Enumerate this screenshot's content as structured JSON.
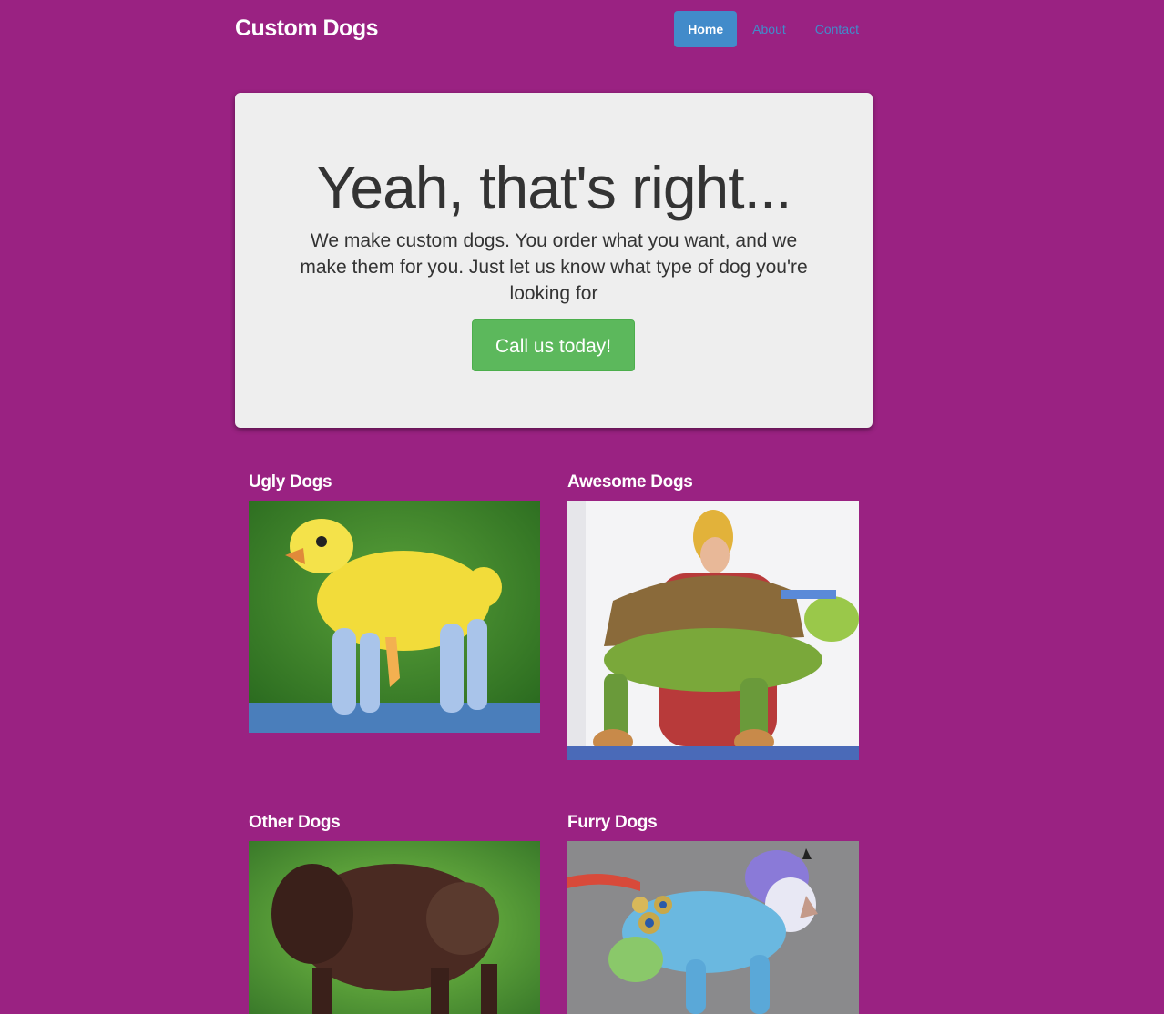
{
  "brand": "Custom Dogs",
  "nav": [
    {
      "label": "Home",
      "active": true
    },
    {
      "label": "About",
      "active": false
    },
    {
      "label": "Contact",
      "active": false
    }
  ],
  "hero": {
    "title": "Yeah, that's right...",
    "lead": "We make custom dogs. You order what you want, and we make them for you. Just let us know what type of dog you're looking for",
    "cta": "Call us today!"
  },
  "sections": [
    {
      "title": "Ugly Dogs",
      "image": "yellow duck-shaped poodle"
    },
    {
      "title": "Awesome Dogs",
      "image": "green turtle-shaped dog held by woman"
    },
    {
      "title": "Other Dogs",
      "image": "brown bison-shaped poodle"
    },
    {
      "title": "Furry Dogs",
      "image": "blue peacock-dyed poodle"
    }
  ],
  "colors": {
    "background": "#9a2282",
    "nav_active": "#428bca",
    "cta": "#5cb85c",
    "hero_bg": "#eeeeee"
  }
}
